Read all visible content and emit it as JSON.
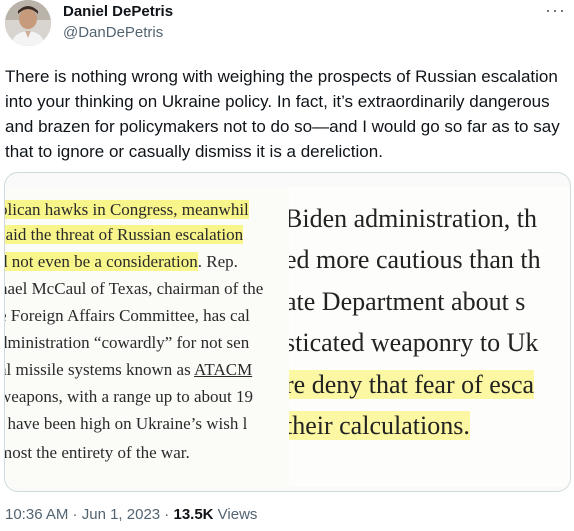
{
  "author": {
    "display_name": "Daniel DePetris",
    "handle": "@DanDePetris"
  },
  "more_icon": "···",
  "tweet": {
    "text": "There is nothing wrong with weighing the prospects of Russian escalation into your thinking on Ukraine policy. In fact, it’s extraordinarily dangerous and brazen for policymakers not to do so—and I would go so far as to say that to ignore or casually dismiss it is a dereliction."
  },
  "media": {
    "left_clip": {
      "line1_hl": "blican hawks in Congress, meanwhil",
      "line2_hl": "said the threat of Russian escalation",
      "line3_hl": "d not even be a consideration",
      "line3_rest": ". Rep.",
      "line4": "nael McCaul of Texas, chairman of the",
      "line5": "e Foreign Affairs Committee, has cal",
      "line6": "dministration “cowardly” for not sen",
      "line7_pre": "al missile systems known as ",
      "line7_ul": "ATACM",
      "line8": "weapons, with a range up to about 19",
      "line9": ", have been high on Ukraine’s wish l",
      "line10": "most the entirety of the war."
    },
    "right_clip": {
      "line1": "Biden administration, th",
      "line2": "ed more cautious than th",
      "line3": "ate Department about s",
      "line4": "sticated weaponry to Uk",
      "line5_hl": "re deny that fear of esca",
      "line6_hl": "their calculations."
    }
  },
  "footer": {
    "time": "10:36 AM",
    "separator": " · ",
    "date": "Jun 1, 2023",
    "views_count": "13.5K",
    "views_label": " Views"
  }
}
